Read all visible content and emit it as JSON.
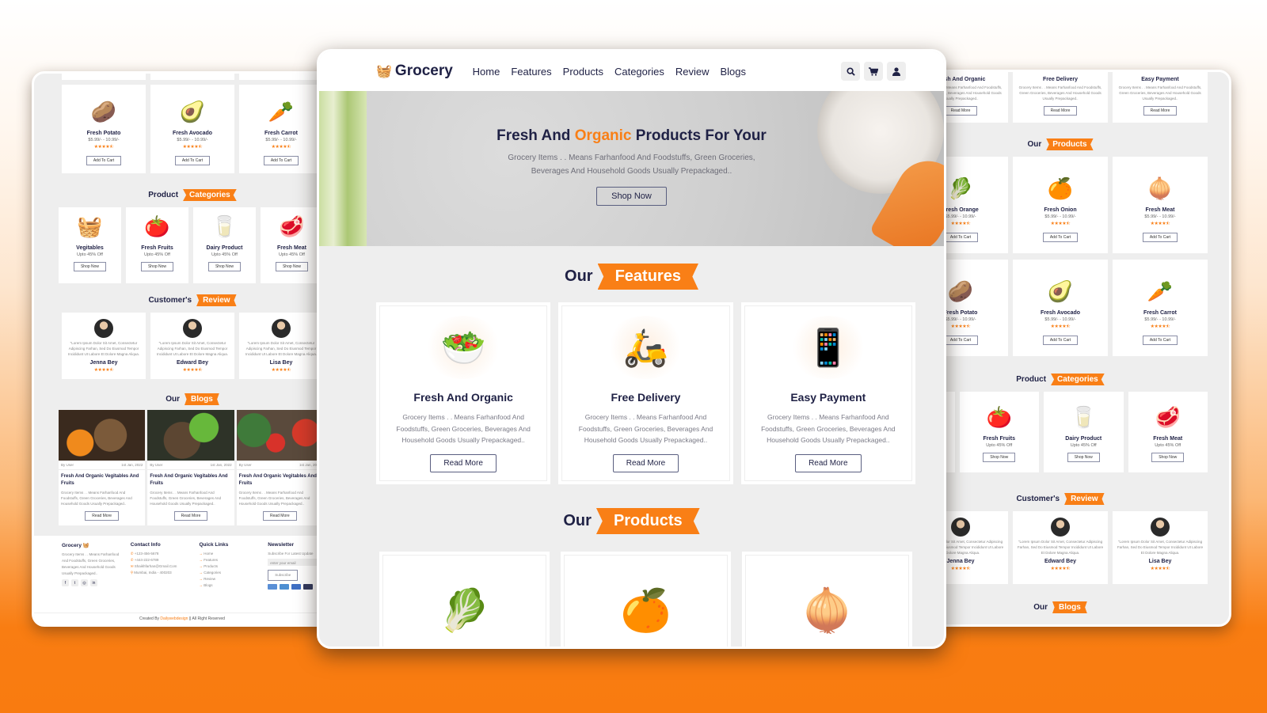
{
  "brand": {
    "name": "Grocery",
    "accent_color": "#f97f16",
    "text_color": "#1f2145"
  },
  "header": {
    "nav": [
      "Home",
      "Features",
      "Products",
      "Categories",
      "Review",
      "Blogs"
    ],
    "icons": [
      "search-icon",
      "cart-icon",
      "user-icon"
    ]
  },
  "hero": {
    "title_pre": "Fresh And",
    "title_accent": "Organic",
    "title_post": "Products For Your",
    "text": "Grocery Items . . Means Farhanfood And Foodstuffs, Green Groceries, Beverages And Household Goods Usually Prepackaged..",
    "button": "Shop Now"
  },
  "features": {
    "title_plain": "Our",
    "title_ribbon": "Features",
    "items": [
      {
        "title": "Fresh And Organic",
        "text": "Grocery Items . . Means Farhanfood And Foodstuffs, Green Groceries, Beverages And Household Goods Usually Prepackaged..",
        "button": "Read More",
        "icon": "🥗"
      },
      {
        "title": "Free Delivery",
        "text": "Grocery Items . . Means Farhanfood And Foodstuffs, Green Groceries, Beverages And Household Goods Usually Prepackaged..",
        "button": "Read More",
        "icon": "🛵"
      },
      {
        "title": "Easy Payment",
        "text": "Grocery Items . . Means Farhanfood And Foodstuffs, Green Groceries, Beverages And Household Goods Usually Prepackaged..",
        "button": "Read More",
        "icon": "📱"
      }
    ]
  },
  "products": {
    "title_plain": "Our",
    "title_ribbon": "Products",
    "items": [
      {
        "name": "Fresh Orange",
        "price": "$5.99/- - 10.99/-",
        "rating": 4.5,
        "button": "Add To Cart",
        "icon": "🥬"
      },
      {
        "name": "Fresh Onion",
        "price": "$5.99/- - 10.99/-",
        "rating": 4.5,
        "button": "Add To Cart",
        "icon": "🍊"
      },
      {
        "name": "Fresh Meat",
        "price": "$5.99/- - 10.99/-",
        "rating": 4.5,
        "button": "Add To Cart",
        "icon": "🧅"
      },
      {
        "name": "Fresh Potato",
        "price": "$5.99/- - 10.99/-",
        "rating": 4.5,
        "button": "Add To Cart",
        "icon": "🥔"
      },
      {
        "name": "Fresh Avocado",
        "price": "$5.99/- - 10.99/-",
        "rating": 4.5,
        "button": "Add To Cart",
        "icon": "🥑"
      },
      {
        "name": "Fresh Carrot",
        "price": "$5.99/- - 10.99/-",
        "rating": 4.5,
        "button": "Add To Cart",
        "icon": "🥕"
      }
    ],
    "stars": "★★★★⯪"
  },
  "categories": {
    "title_plain": "Product",
    "title_ribbon": "Categories",
    "items": [
      {
        "name": "Vegitables",
        "discount": "Upto 45% Off",
        "button": "Shop Now",
        "icon": "🧺"
      },
      {
        "name": "Fresh Fruits",
        "discount": "Upto 45% Off",
        "button": "Shop Now",
        "icon": "🍅"
      },
      {
        "name": "Dairy Product",
        "discount": "Upto 45% Off",
        "button": "Shop Now",
        "icon": "🥛"
      },
      {
        "name": "Fresh Meat",
        "discount": "Upto 45% Off",
        "button": "Shop Now",
        "icon": "🥩"
      }
    ]
  },
  "reviews": {
    "title_plain": "Customer's",
    "title_ribbon": "Review",
    "text": "\"Lorem Ipsum Dolor Sit Amet, Consectetur Adipiscing Farhan, Sed Do Eiusmod Tempor Incididunt Ut Labore Et Dolore Magna Aliqua.",
    "items": [
      {
        "name": "Jenna Bey",
        "rating": 4.5
      },
      {
        "name": "Edward Bey",
        "rating": 4.5
      },
      {
        "name": "Lisa Bey",
        "rating": 4.5
      }
    ]
  },
  "blogs": {
    "title_plain": "Our",
    "title_ribbon": "Blogs",
    "items": [
      {
        "author": "By User",
        "date": "1st Jan, 2022",
        "title": "Fresh And Organic Vegitables And Fruits",
        "text": "Grocery Items . . Means Farhanfood And Foodstuffs, Green Groceries, Beverages And Household Goods Usually Prepackaged..",
        "button": "Read More"
      },
      {
        "author": "By User",
        "date": "1st Jan, 2022",
        "title": "Fresh And Organic Vegitables And Fruits",
        "text": "Grocery Items . . Means Farhanfood And Foodstuffs, Green Groceries, Beverages And Household Goods Usually Prepackaged..",
        "button": "Read More"
      },
      {
        "author": "By User",
        "date": "1st Jan, 2022",
        "title": "Fresh And Organic Vegitables And Fruits",
        "text": "Grocery Items . . Means Farhanfood And Foodstuffs, Green Groceries, Beverages And Household Goods Usually Prepackaged..",
        "button": "Read More"
      }
    ]
  },
  "footer": {
    "about_title": "Grocery",
    "about_text": "Grocery Items . . Means Farhanfood And Foodstuffs, Green Groceries, Beverages And Household Goods Usually Prepackaged..",
    "contact_title": "Contact Info",
    "contacts": [
      "+123-456-5678",
      "+444-222-6789",
      "Shaikhfarhan@Gmail.Com",
      "Mumbai, India - 400203"
    ],
    "links_title": "Quick Links",
    "links": [
      "Home",
      "Features",
      "Products",
      "Categories",
      "Review",
      "Blogs"
    ],
    "newsletter_title": "Newsletter",
    "newsletter_text": "Subscribe For Latest Update",
    "email_placeholder": "enter your email",
    "subscribe": "Subscribe",
    "copyright_pre": "Created By",
    "copyright_brand": "Dailywebdesign",
    "copyright_post": "|| All Right Reserved"
  }
}
